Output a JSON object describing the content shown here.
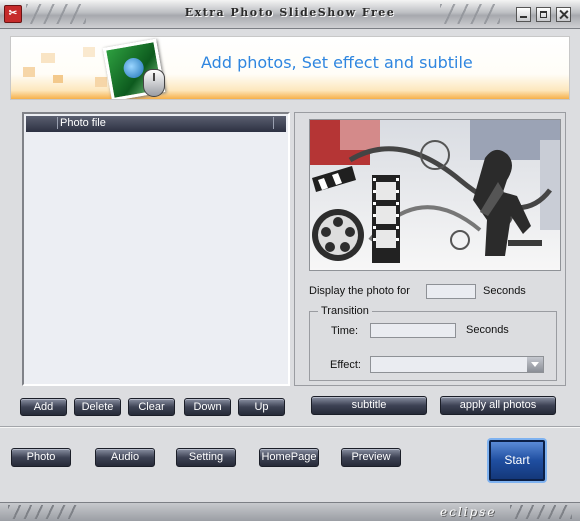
{
  "window": {
    "title": "Extra Photo SlideShow Free"
  },
  "banner": {
    "headline": "Add photos, Set effect and subtile"
  },
  "photo_list": {
    "column_header": "Photo file",
    "items": []
  },
  "list_buttons": {
    "add": "Add",
    "delete": "Delete",
    "clear": "Clear",
    "down": "Down",
    "up": "Up"
  },
  "settings": {
    "display_label": "Display the photo for",
    "display_value": "",
    "seconds_unit": "Seconds",
    "transition_legend": "Transition",
    "time_label": "Time:",
    "time_value": "",
    "time_unit": "Seconds",
    "effect_label": "Effect:",
    "effect_value": ""
  },
  "action_buttons": {
    "subtitle": "subtitle",
    "apply_all": "apply all photos"
  },
  "nav_buttons": {
    "photo": "Photo",
    "audio": "Audio",
    "setting": "Setting",
    "homepage": "HomePage",
    "preview": "Preview",
    "start": "Start"
  },
  "footer": {
    "brand": "eclipse"
  },
  "colors": {
    "banner_text": "#2f86e0",
    "button_dark": "#2d3142",
    "start_button": "#1f4ea0"
  },
  "icons": {
    "app": "app-logo-icon",
    "minimize": "minimize-icon",
    "maximize": "maximize-icon",
    "close": "close-icon",
    "dropdown": "chevron-down-icon"
  }
}
